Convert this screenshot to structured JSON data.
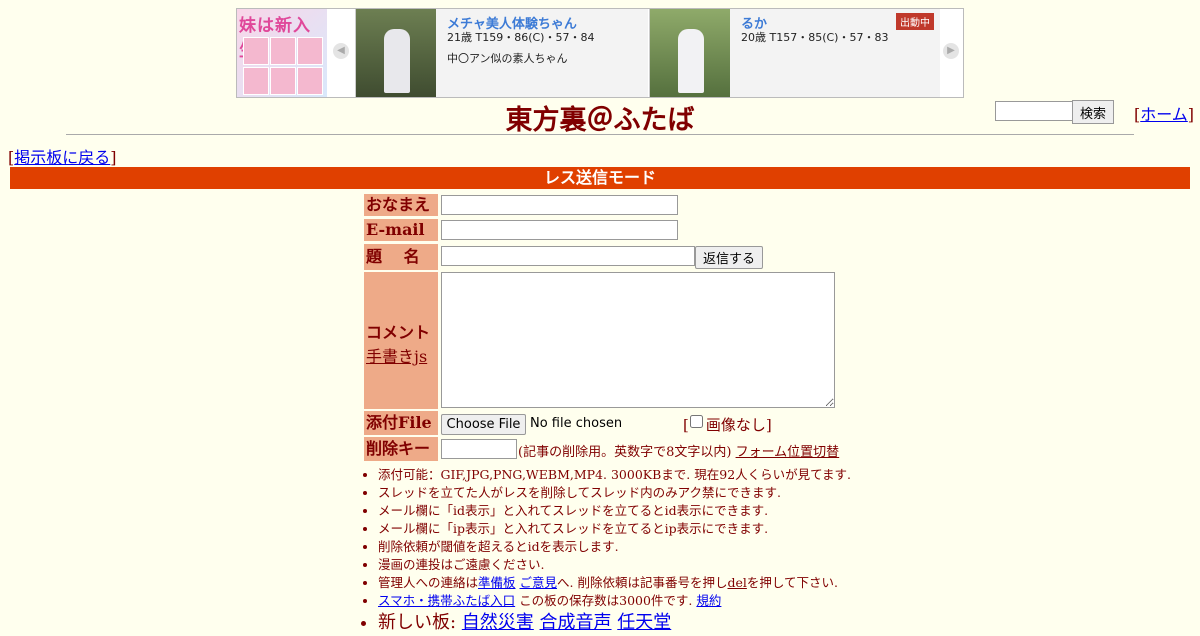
{
  "ad_banner": {
    "left_logo_text": "妹は新入生",
    "prev_arrow_icon": "chevron-left-icon",
    "next_arrow_icon": "chevron-right-icon",
    "cards": [
      {
        "name": "メチャ美人体験ちゃん",
        "spec": "21歳 T159・86(C)・57・84",
        "desc": "中〇アン似の素人ちゃん",
        "badge": ""
      },
      {
        "name": "るか",
        "spec": "20歳 T157・85(C)・57・83",
        "desc": "",
        "badge": "出動中"
      }
    ]
  },
  "header": {
    "title": "東方裏＠ふたば",
    "search_placeholder": "",
    "search_button": "検索",
    "home_link": "ホーム",
    "back_link": "掲示板に戻る"
  },
  "mode_title": "レス送信モード",
  "form": {
    "name_label": "おなまえ",
    "email_label": "E-mail",
    "subject_label": "題　 名",
    "submit_button": "返信する",
    "comment_label": "コメント",
    "handwrite_link": "手書きjs",
    "file_label": "添付File",
    "file_button": "Choose File",
    "file_status": "No file chosen",
    "no_image_label": "画像なし",
    "delkey_label": "削除キー",
    "delkey_note": "(記事の削除用。英数字で8文字以内)",
    "form_position_link": "フォーム位置切替"
  },
  "notes": {
    "n1": "添付可能：GIF,JPG,PNG,WEBM,MP4. 3000KBまで. 現在92人くらいが見てます.",
    "n2": "スレッドを立てた人がレスを削除してスレッド内のみアク禁にできます.",
    "n3": "メール欄に「id表示」と入れてスレッドを立てるとid表示にできます.",
    "n4": "メール欄に「ip表示」と入れてスレッドを立てるとip表示にできます.",
    "n5": "削除依頼が閾値を超えるとidを表示します.",
    "n6": "漫画の連投はご遠慮ください.",
    "n7_prefix": "管理人への連絡は",
    "n7_link1": "準備板",
    "n7_link2": "ご意見",
    "n7_mid": "へ. 削除依頼は記事番号を押し",
    "n7_del": "del",
    "n7_suffix": "を押して下さい.",
    "n8_link": "スマホ・携帯ふたば入口",
    "n8_text": " この板の保存数は3000件です.",
    "n8_rules": "規約",
    "n9_prefix": "新しい板: ",
    "n9_links": [
      "自然災害",
      "合成音声",
      "任天堂"
    ]
  }
}
